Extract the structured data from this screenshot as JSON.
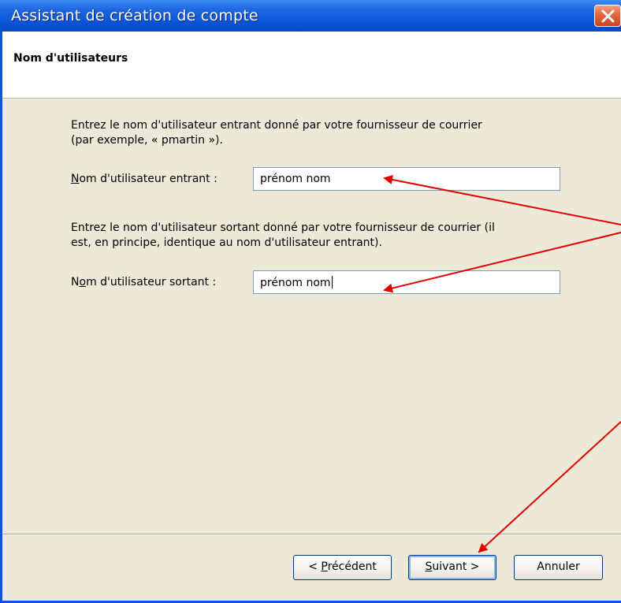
{
  "window": {
    "title": "Assistant de création de compte"
  },
  "header": {
    "page_title": "Nom d'utilisateurs"
  },
  "incoming": {
    "instructions_line1": "Entrez le nom d'utilisateur entrant donné par votre fournisseur de courrier",
    "instructions_line2": "(par exemple, « pmartin »).",
    "label_mnemonic": "N",
    "label_rest": "om d'utilisateur entrant :",
    "value": "prénom nom"
  },
  "outgoing": {
    "instructions_line1": "Entrez le nom d'utilisateur sortant donné par votre fournisseur de courrier (il",
    "instructions_line2": "est, en principe, identique au nom d'utilisateur entrant).",
    "label_pre": "N",
    "label_mnemonic": "o",
    "label_rest": "m d'utilisateur sortant :",
    "value": "prénom nom"
  },
  "buttons": {
    "back_pre": "< ",
    "back_mnemonic": "P",
    "back_rest": "récédent",
    "next_mnemonic": "S",
    "next_rest": "uivant >",
    "cancel": "Annuler"
  },
  "colors": {
    "titlebar": "#0a54d8",
    "annotation_arrows": "#e00000",
    "dialog_bg": "#ece9d8"
  },
  "icons": {
    "close": "close-icon"
  }
}
